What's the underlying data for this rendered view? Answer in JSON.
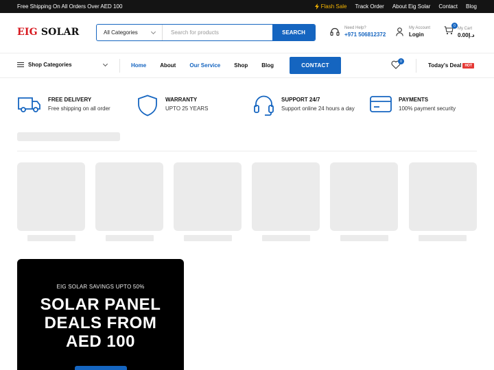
{
  "topbar": {
    "shipping_text": "Free Shipping On All Orders Over AED 100",
    "links": [
      "Flash Sale",
      "Track Order",
      "About Eig Solar",
      "Contact",
      "Blog"
    ]
  },
  "header": {
    "logo_part1": "EIG",
    "logo_part2": "SOLAR",
    "category_select": "All Categories",
    "search_placeholder": "Search for products",
    "search_button": "SEARCH",
    "help_label": "Need Help?",
    "help_phone": "+971 506812372",
    "account_label": "My Account",
    "account_action": "Login",
    "cart_label": "My Cart",
    "cart_total": "0.00د.إ",
    "cart_count": "0"
  },
  "nav": {
    "shop_categories": "Shop Categories",
    "links": [
      {
        "label": "Home",
        "color": "#1565c0"
      },
      {
        "label": "About",
        "color": "#111111"
      },
      {
        "label": "Our Service",
        "color": "#1565c0"
      },
      {
        "label": "Shop",
        "color": "#111111"
      },
      {
        "label": "Blog",
        "color": "#111111"
      }
    ],
    "contact_button": "CONTACT",
    "wishlist_count": "0",
    "todays_deal": "Today's Deal",
    "hot_badge": "HOT"
  },
  "features": [
    {
      "title": "FREE DELIVERY",
      "subtitle": "Free shipping on all order",
      "icon": "truck-icon"
    },
    {
      "title": "WARRANTY",
      "subtitle": "UPTO 25 YEARS",
      "icon": "shield-icon"
    },
    {
      "title": "SUPPORT 24/7",
      "subtitle": "Support online 24 hours a day",
      "icon": "headset-icon"
    },
    {
      "title": "PAYMENTS",
      "subtitle": "100% payment security",
      "icon": "credit-card-icon"
    }
  ],
  "promo": {
    "kicker": "EIG SOLAR SAVINGS UPTO 50%",
    "headline_line1": "SOLAR PANEL",
    "headline_line2": "DEALS FROM",
    "headline_line3": "AED 100"
  },
  "colors": {
    "accent": "#1565c0",
    "brand_red": "#d71920",
    "flash": "#f5b400",
    "hot": "#e53935"
  }
}
